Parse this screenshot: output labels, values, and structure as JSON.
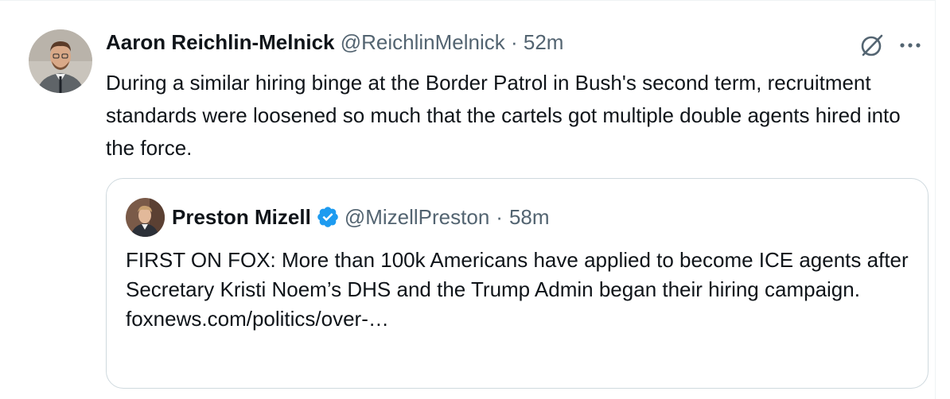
{
  "tweet": {
    "author_name": "Aaron Reichlin-Melnick",
    "handle": "@ReichlinMelnick",
    "separator": "·",
    "time": "52m",
    "text": "During a similar hiring binge at the Border Patrol in Bush's second term, recruitment standards were loosened so much that the cartels got multiple double agents hired into the force."
  },
  "quoted_tweet": {
    "author_name": "Preston Mizell",
    "handle": "@MizellPreston",
    "separator": "·",
    "time": "58m",
    "text": "FIRST ON FOX: More than 100k Americans have applied to become ICE agents after Secretary Kristi Noem’s DHS and the Trump Admin began their hiring campaign.",
    "link": "foxnews.com/politics/over-…"
  },
  "icons": {
    "grok": "grok-icon",
    "more": "more-options-icon",
    "verified": "verified-badge-icon"
  },
  "colors": {
    "text": "#0f1419",
    "muted": "#536471",
    "verified": "#1d9bf0",
    "border": "#cfd9de"
  }
}
